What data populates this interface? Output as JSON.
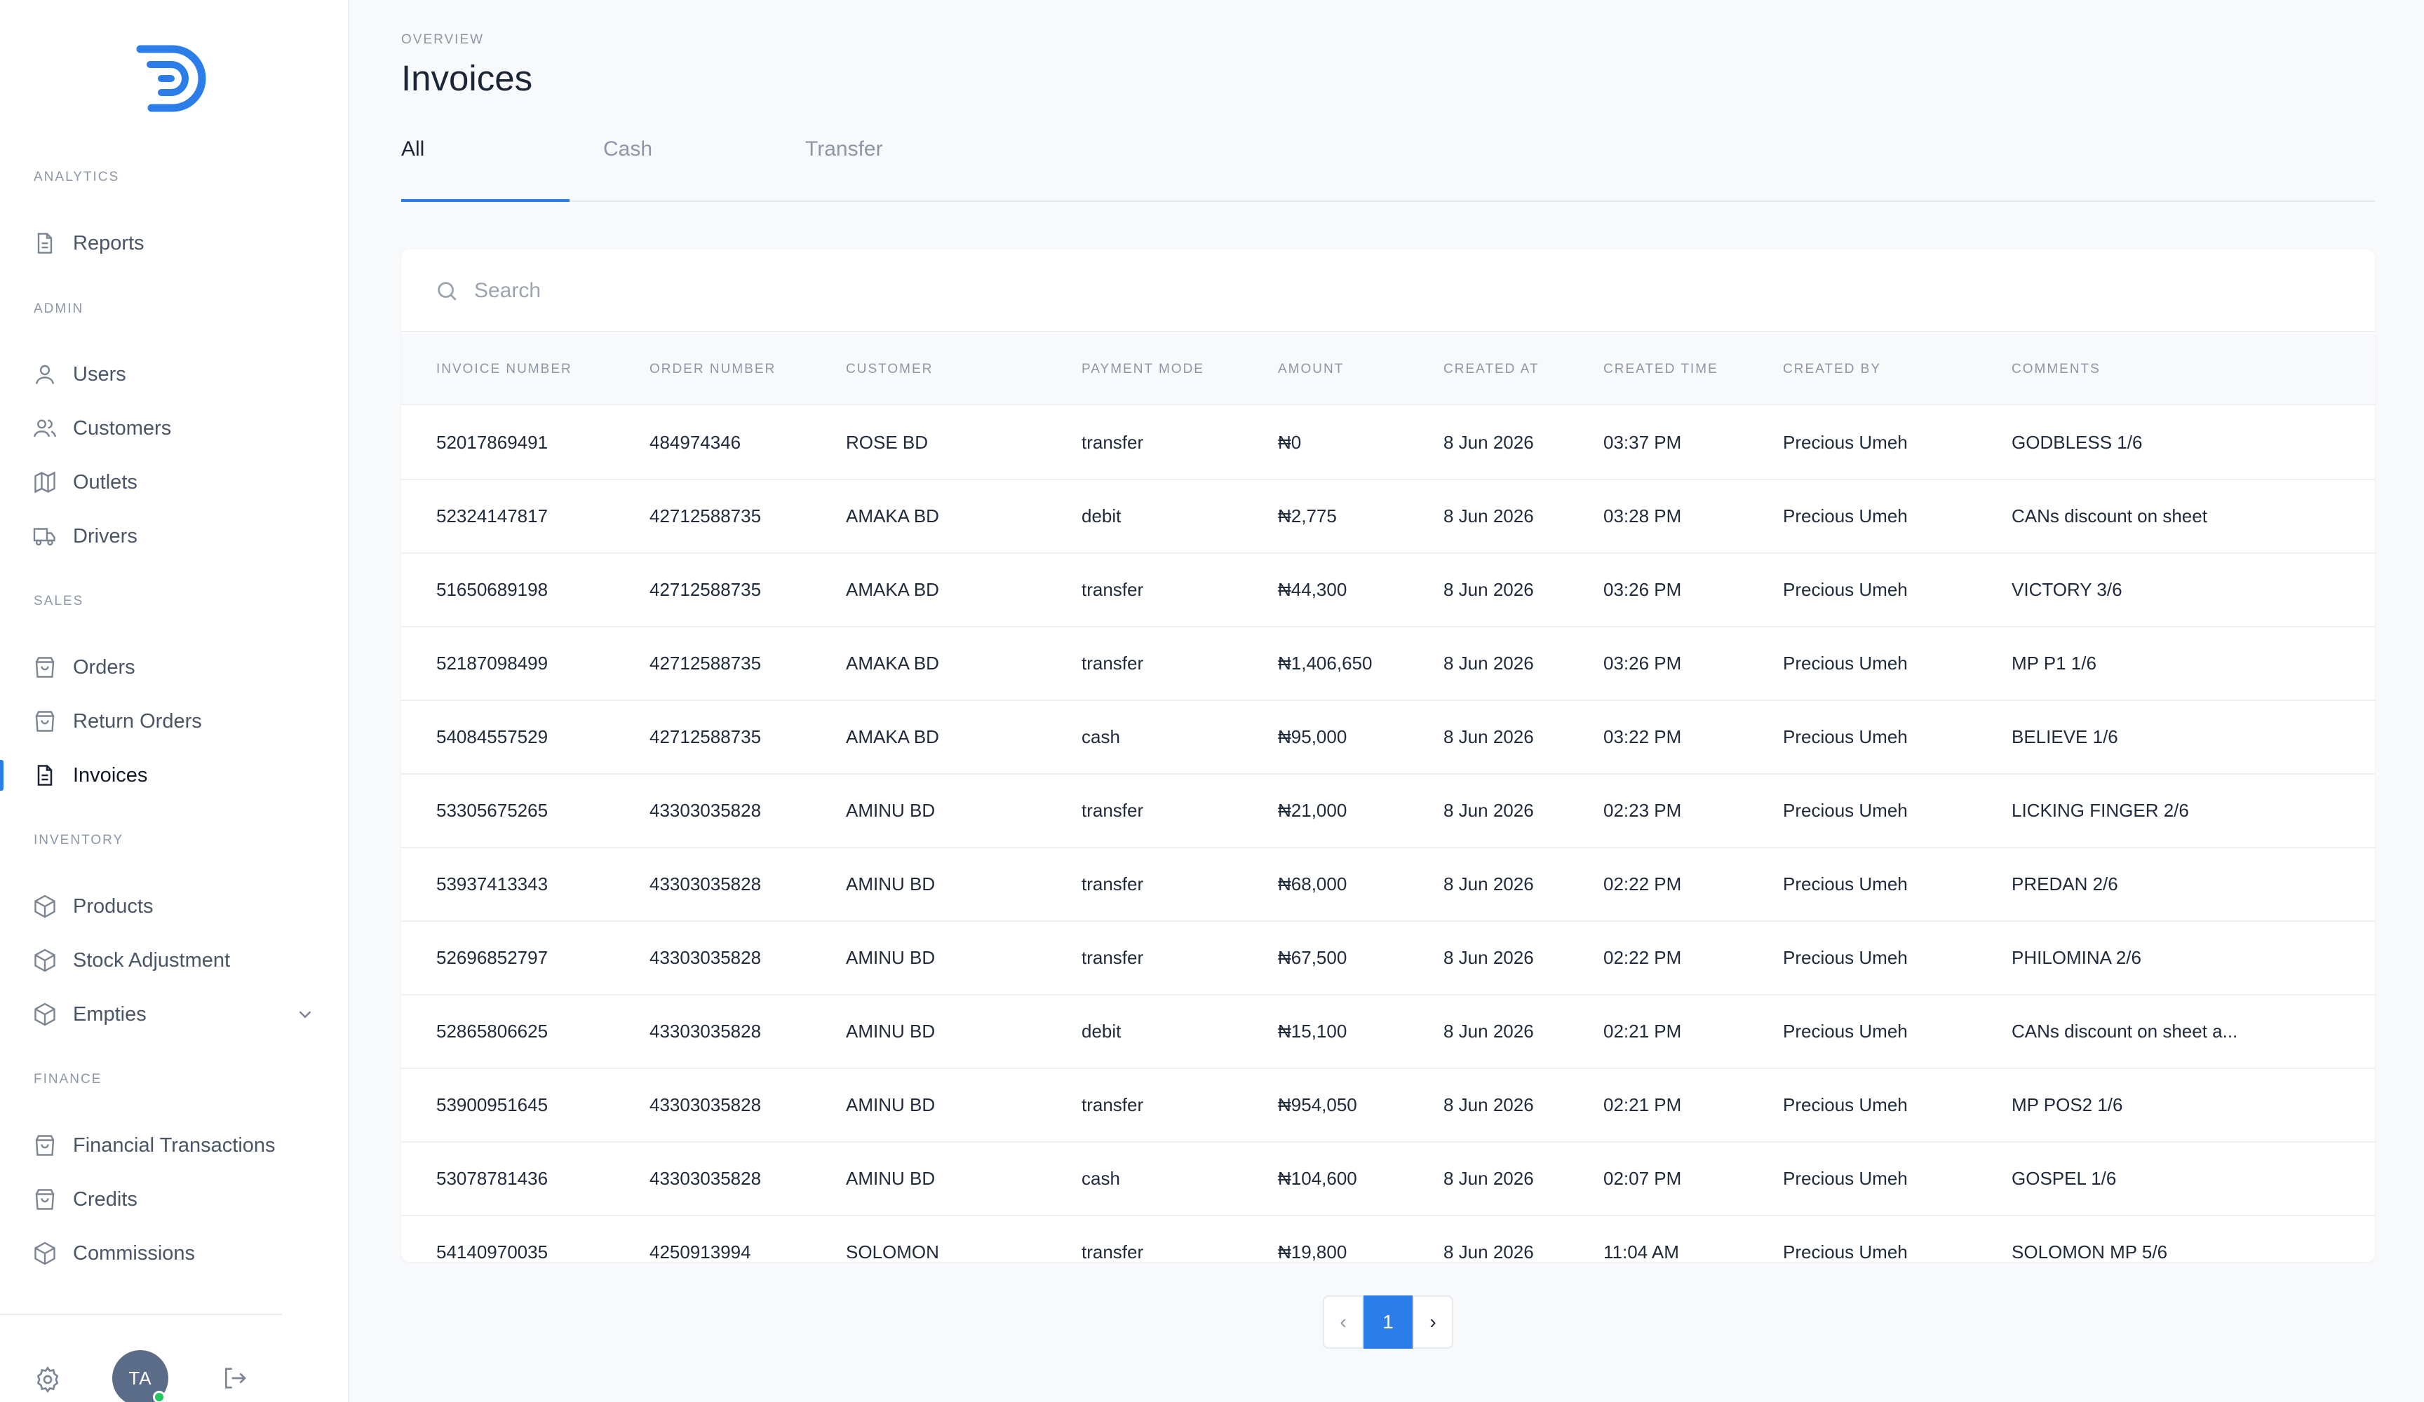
{
  "sidebar": {
    "sections": {
      "analytics": "ANALYTICS",
      "admin": "ADMIN",
      "sales": "SALES",
      "inventory": "INVENTORY",
      "finance": "FINANCE"
    },
    "items": {
      "reports": "Reports",
      "users": "Users",
      "customers": "Customers",
      "outlets": "Outlets",
      "drivers": "Drivers",
      "orders": "Orders",
      "return_orders": "Return Orders",
      "invoices": "Invoices",
      "products": "Products",
      "stock_adjustment": "Stock Adjustment",
      "empties": "Empties",
      "financial_transactions": "Financial Transactions",
      "credits": "Credits",
      "commissions": "Commissions"
    },
    "avatar_initials": "TA"
  },
  "header": {
    "overline": "OVERVIEW",
    "title": "Invoices"
  },
  "tabs": [
    "All",
    "Cash",
    "Transfer"
  ],
  "search": {
    "placeholder": "Search"
  },
  "table": {
    "columns": [
      "INVOICE NUMBER",
      "ORDER NUMBER",
      "CUSTOMER",
      "PAYMENT MODE",
      "AMOUNT",
      "CREATED AT",
      "CREATED TIME",
      "CREATED BY",
      "COMMENTS"
    ],
    "rows": [
      [
        "52017869491",
        "484974346",
        "ROSE BD",
        "transfer",
        "₦0",
        "8 Jun 2026",
        "03:37 PM",
        "Precious Umeh",
        "GODBLESS 1/6"
      ],
      [
        "52324147817",
        "42712588735",
        "AMAKA BD",
        "debit",
        "₦2,775",
        "8 Jun 2026",
        "03:28 PM",
        "Precious Umeh",
        "CANs discount on sheet"
      ],
      [
        "51650689198",
        "42712588735",
        "AMAKA BD",
        "transfer",
        "₦44,300",
        "8 Jun 2026",
        "03:26 PM",
        "Precious Umeh",
        "VICTORY 3/6"
      ],
      [
        "52187098499",
        "42712588735",
        "AMAKA BD",
        "transfer",
        "₦1,406,650",
        "8 Jun 2026",
        "03:26 PM",
        "Precious Umeh",
        "MP P1 1/6"
      ],
      [
        "54084557529",
        "42712588735",
        "AMAKA BD",
        "cash",
        "₦95,000",
        "8 Jun 2026",
        "03:22 PM",
        "Precious Umeh",
        "BELIEVE 1/6"
      ],
      [
        "53305675265",
        "43303035828",
        "AMINU BD",
        "transfer",
        "₦21,000",
        "8 Jun 2026",
        "02:23 PM",
        "Precious Umeh",
        "LICKING FINGER 2/6"
      ],
      [
        "53937413343",
        "43303035828",
        "AMINU BD",
        "transfer",
        "₦68,000",
        "8 Jun 2026",
        "02:22 PM",
        "Precious Umeh",
        "PREDAN 2/6"
      ],
      [
        "52696852797",
        "43303035828",
        "AMINU BD",
        "transfer",
        "₦67,500",
        "8 Jun 2026",
        "02:22 PM",
        "Precious Umeh",
        "PHILOMINA 2/6"
      ],
      [
        "52865806625",
        "43303035828",
        "AMINU BD",
        "debit",
        "₦15,100",
        "8 Jun 2026",
        "02:21 PM",
        "Precious Umeh",
        "CANs discount on sheet a..."
      ],
      [
        "53900951645",
        "43303035828",
        "AMINU BD",
        "transfer",
        "₦954,050",
        "8 Jun 2026",
        "02:21 PM",
        "Precious Umeh",
        "MP POS2 1/6"
      ],
      [
        "53078781436",
        "43303035828",
        "AMINU BD",
        "cash",
        "₦104,600",
        "8 Jun 2026",
        "02:07 PM",
        "Precious Umeh",
        "GOSPEL 1/6"
      ],
      [
        "54140970035",
        "4250913994",
        "SOLOMON",
        "transfer",
        "₦19,800",
        "8 Jun 2026",
        "11:04 AM",
        "Precious Umeh",
        "SOLOMON MP 5/6"
      ]
    ]
  },
  "pagination": {
    "prev": "‹",
    "current": "1",
    "next": "›"
  },
  "colors": {
    "accent": "#2b7de9",
    "online": "#22c55e"
  }
}
